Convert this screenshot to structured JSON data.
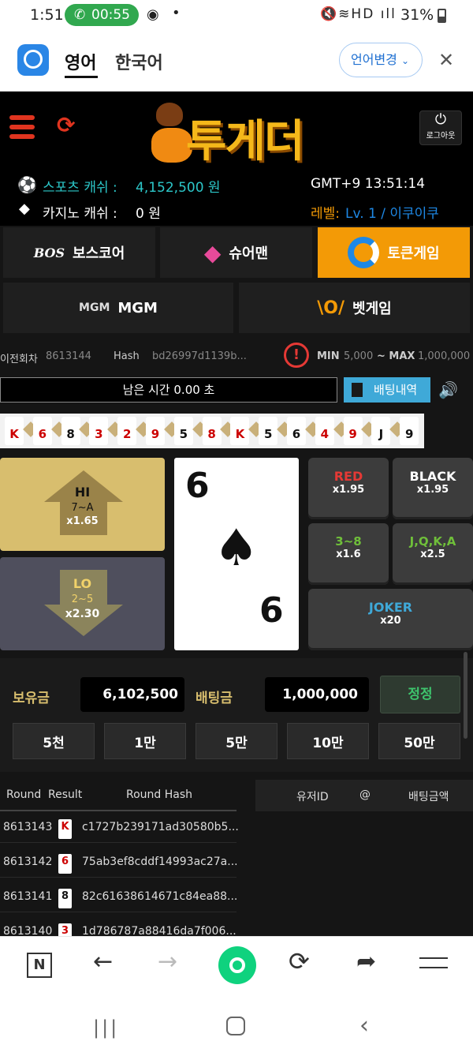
{
  "status_bar": {
    "time": "1:51",
    "call_timer": "00:55",
    "battery": "31%"
  },
  "top_bar": {
    "lang_en": "영어",
    "lang_ko": "한국어",
    "change_lang_button": "언어변경"
  },
  "header": {
    "logo_text": "투게더",
    "logout_label": "로그아웃",
    "sports_cash_label": "스포츠 캐쉬 :",
    "sports_cash_value": "4,152,500 원",
    "casino_cash_label": "카지노 캐쉬 :",
    "casino_cash_value": "0 원",
    "clock": "GMT+9 13:51:14",
    "level_label": "레벨:",
    "level_value": "Lv. 1 / 이쿠이쿠"
  },
  "games_menu": [
    {
      "label": "보스코어",
      "badge": "BOS"
    },
    {
      "label": "슈어맨",
      "badge": ""
    },
    {
      "label": "토큰게임",
      "badge": ""
    },
    {
      "label": "MGM",
      "badge": "MGM"
    },
    {
      "label": "벳게임",
      "badge": "\\O/"
    }
  ],
  "round_info": {
    "prev_round_label": "이전회차",
    "prev_round_value": "8613144",
    "hash_label": "Hash",
    "hash_value": "bd26997d1139b...",
    "min_label": "MIN",
    "min_value": "5,000",
    "max_label": "~ MAX",
    "max_value": "1,000,000"
  },
  "timer": {
    "remaining": "남은 시간 0.00 초",
    "history_button": "배팅내역"
  },
  "history_cards": [
    {
      "rank": "K",
      "color": "#c00"
    },
    {
      "rank": "6",
      "color": "#c00"
    },
    {
      "rank": "8",
      "color": "#111"
    },
    {
      "rank": "3",
      "color": "#c00"
    },
    {
      "rank": "2",
      "color": "#c00"
    },
    {
      "rank": "9",
      "color": "#c00"
    },
    {
      "rank": "5",
      "color": "#111"
    },
    {
      "rank": "8",
      "color": "#c00"
    },
    {
      "rank": "K",
      "color": "#c00"
    },
    {
      "rank": "5",
      "color": "#111"
    },
    {
      "rank": "6",
      "color": "#111"
    },
    {
      "rank": "4",
      "color": "#c00"
    },
    {
      "rank": "9",
      "color": "#c00"
    },
    {
      "rank": "J",
      "color": "#111"
    },
    {
      "rank": "9",
      "color": "#111"
    }
  ],
  "current_card": {
    "rank": "6",
    "suit": "♠"
  },
  "hi": {
    "label": "HI",
    "range": "7~A",
    "odds": "x1.65"
  },
  "lo": {
    "label": "LO",
    "range": "2~5",
    "odds": "x2.30"
  },
  "bets": {
    "red": {
      "label": "RED",
      "odds": "x1.95"
    },
    "black": {
      "label": "BLACK",
      "odds": "x1.95"
    },
    "three_eight": {
      "label": "3~8",
      "odds": "x1.6"
    },
    "jqka": {
      "label": "J,Q,K,A",
      "odds": "x2.5"
    },
    "joker": {
      "label": "JOKER",
      "odds": "x20"
    }
  },
  "wallet": {
    "balance_label": "보유금",
    "balance_value": "6,102,500",
    "bet_label": "배팅금",
    "bet_value": "1,000,000",
    "reset_button": "정정"
  },
  "chips": [
    "5천",
    "1만",
    "5만",
    "10만",
    "50만"
  ],
  "results_table": {
    "col_round": "Round",
    "col_result": "Result",
    "col_hash": "Round Hash",
    "rows": [
      {
        "round": "8613143",
        "card": "K",
        "hash": "c1727b239171ad30580b5..."
      },
      {
        "round": "8613142",
        "card": "6",
        "hash": "75ab3ef8cddf14993ac27a..."
      },
      {
        "round": "8613141",
        "card": "8",
        "hash": "82c61638614671c84ea88..."
      },
      {
        "round": "8613140",
        "card": "3",
        "hash": "1d786787a88416da7f006..."
      }
    ]
  },
  "bets_table": {
    "col_user": "유저ID",
    "col_at": "@",
    "col_amount": "배팅금액"
  },
  "colors": {
    "accent": "#f39a06",
    "gold": "#d8be6e",
    "cyan": "#2cc7c9",
    "blue": "#1e88e5"
  }
}
